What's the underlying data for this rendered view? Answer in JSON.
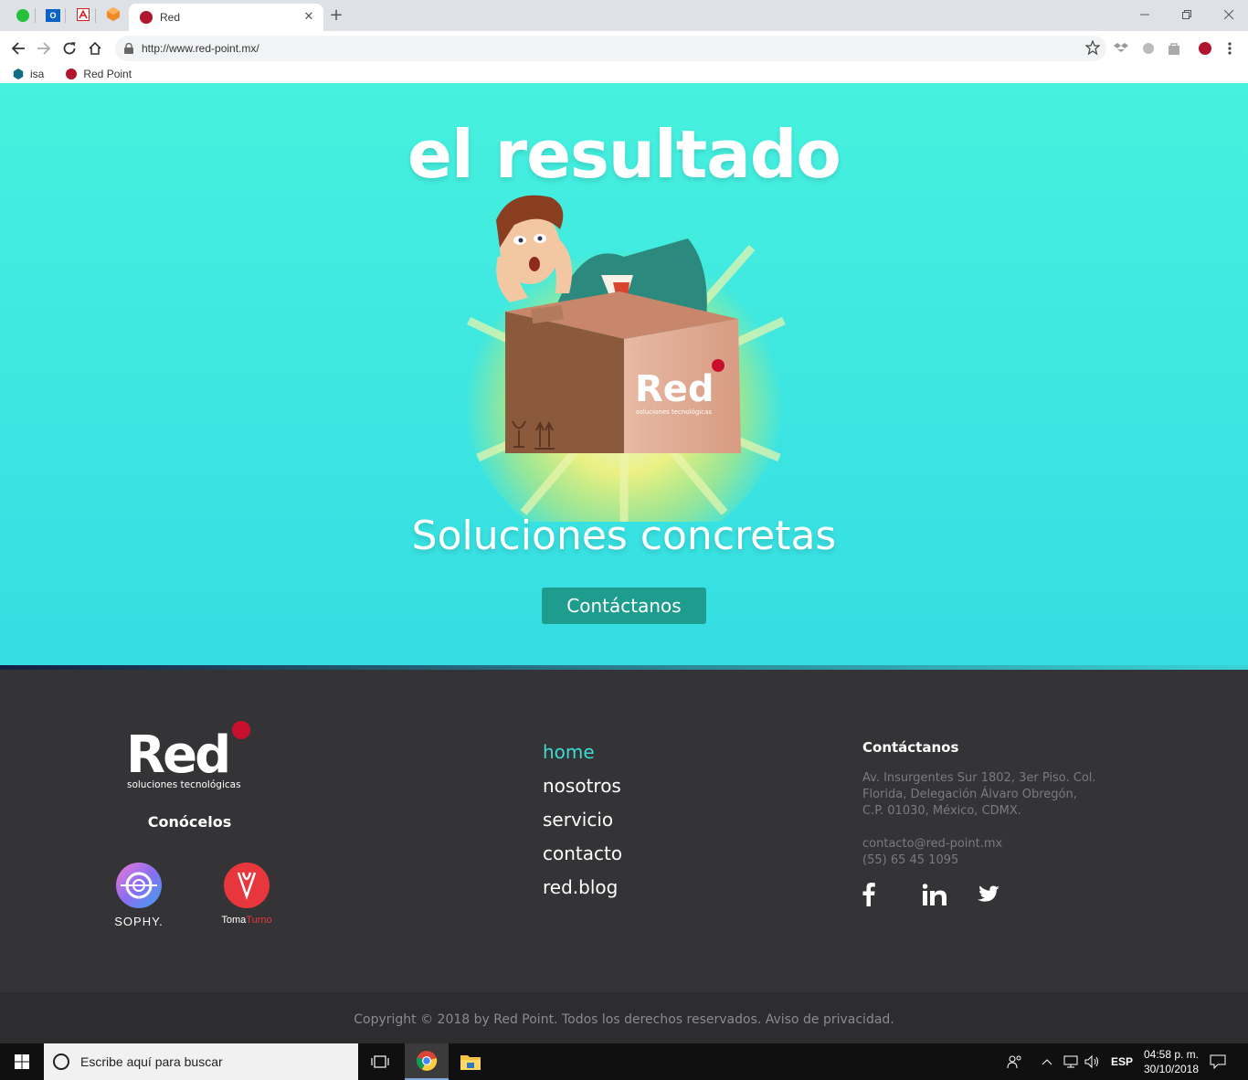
{
  "browser": {
    "tab_title": "Red",
    "url": "http://www.red-point.mx/",
    "bookmarks": [
      {
        "label": "isa"
      },
      {
        "label": "Red Point"
      }
    ]
  },
  "hero": {
    "title": "el resultado",
    "subtitle": "Soluciones concretas",
    "cta_label": "Contáctanos",
    "box_brand": "Red",
    "box_tagline": "soluciones tecnológicas"
  },
  "footer": {
    "logo_word": "Red",
    "logo_tagline": "soluciones tecnológicas",
    "conocelos_label": "Conócelos",
    "partners": [
      {
        "label": "SOPHY."
      },
      {
        "label_a": "Toma",
        "label_b": "Turno"
      }
    ],
    "nav": [
      {
        "label": "home"
      },
      {
        "label": "nosotros"
      },
      {
        "label": "servicio"
      },
      {
        "label": "contacto"
      },
      {
        "label": "red.blog"
      }
    ],
    "contact": {
      "heading": "Contáctanos",
      "address_1": "Av. Insurgentes Sur 1802, 3er Piso. Col.",
      "address_2": "Florida, Delegación Álvaro Obregón,",
      "address_3": "C.P. 01030, México, CDMX.",
      "email": "contacto@red-point.mx",
      "phone": "(55) 65 45 1095"
    },
    "copyright": "Copyright © 2018 by Red Point. Todos los derechos reservados. Aviso de privacidad."
  },
  "taskbar": {
    "search_placeholder": "Escribe aquí para buscar",
    "language": "ESP",
    "time": "04:58 p. m.",
    "date": "30/10/2018"
  },
  "colors": {
    "hero_top": "#46f1de",
    "hero_bottom": "#35dde3",
    "cta": "#1e9d8e",
    "footer_bg": "#343437",
    "nav_active": "#3fdbd3",
    "brand_red": "#c8102e"
  }
}
